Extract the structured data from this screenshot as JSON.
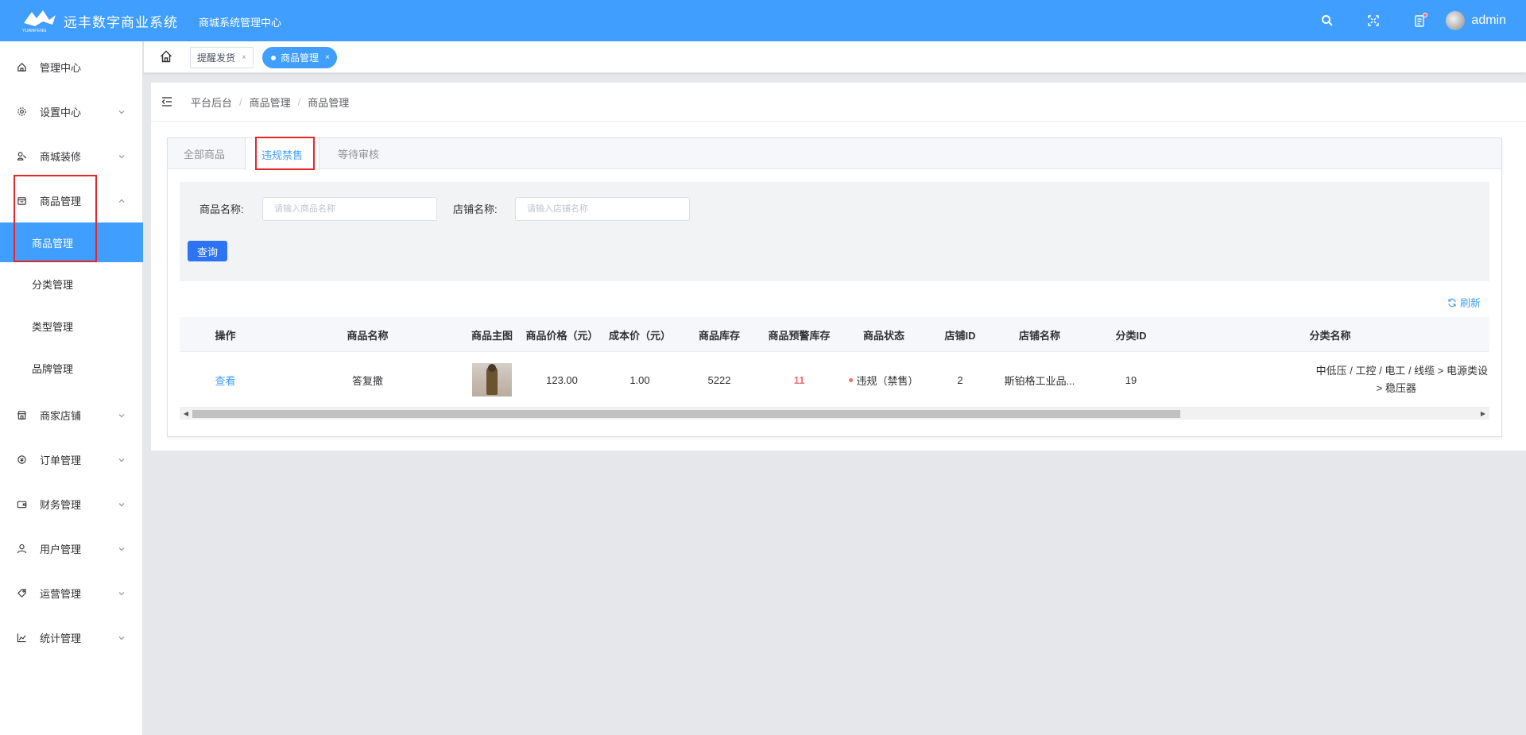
{
  "header": {
    "logo_text": "YUANFENG",
    "title": "远丰数字商业系统",
    "subtitle": "商城系统管理中心",
    "user": "admin"
  },
  "sidebar": {
    "items": [
      {
        "label": "管理中心",
        "icon": "home-icon"
      },
      {
        "label": "设置中心",
        "icon": "gear-icon"
      },
      {
        "label": "商城装修",
        "icon": "decorate-icon"
      },
      {
        "label": "商品管理",
        "icon": "product-icon"
      },
      {
        "label": "商家店铺",
        "icon": "store-icon"
      },
      {
        "label": "订单管理",
        "icon": "order-icon"
      },
      {
        "label": "财务管理",
        "icon": "wallet-icon"
      },
      {
        "label": "用户管理",
        "icon": "user-icon"
      },
      {
        "label": "运营管理",
        "icon": "tag-icon"
      },
      {
        "label": "统计管理",
        "icon": "chart-icon"
      }
    ],
    "sub_items": [
      {
        "label": "商品管理"
      },
      {
        "label": "分类管理"
      },
      {
        "label": "类型管理"
      },
      {
        "label": "品牌管理"
      }
    ]
  },
  "tags": [
    {
      "label": "提醒发货",
      "close": "×"
    },
    {
      "label": "商品管理",
      "close": "×"
    }
  ],
  "breadcrumb": [
    "平台后台",
    "商品管理",
    "商品管理"
  ],
  "breadcrumb_sep": "/",
  "tabs": [
    "全部商品",
    "违规禁售",
    "等待审核"
  ],
  "search": {
    "name_label": "商品名称:",
    "name_placeholder": "请输入商品名称",
    "store_label": "店铺名称:",
    "store_placeholder": "请输入店铺名称",
    "query_label": "查询"
  },
  "refresh_label": "刷新",
  "table": {
    "columns": [
      "操作",
      "商品名称",
      "商品主图",
      "商品价格（元）",
      "成本价（元）",
      "商品库存",
      "商品预警库存",
      "商品状态",
      "店铺ID",
      "店铺名称",
      "分类ID",
      "分类名称"
    ],
    "rows": [
      {
        "action": "查看",
        "name": "答复撒",
        "price": "123.00",
        "cost": "1.00",
        "stock": "5222",
        "warn_stock": "11",
        "status": "违规（禁售）",
        "store_id": "2",
        "store_name": "斯铂格工业品...",
        "cat_id": "19",
        "cat_line1": "中低压 / 工控 / 电工 / 线缆 > 电源类设",
        "cat_line2": "> 稳压器"
      }
    ]
  },
  "colors": {
    "primary": "#409eff",
    "highlight": "#e5262b",
    "danger": "#f56c6c"
  }
}
